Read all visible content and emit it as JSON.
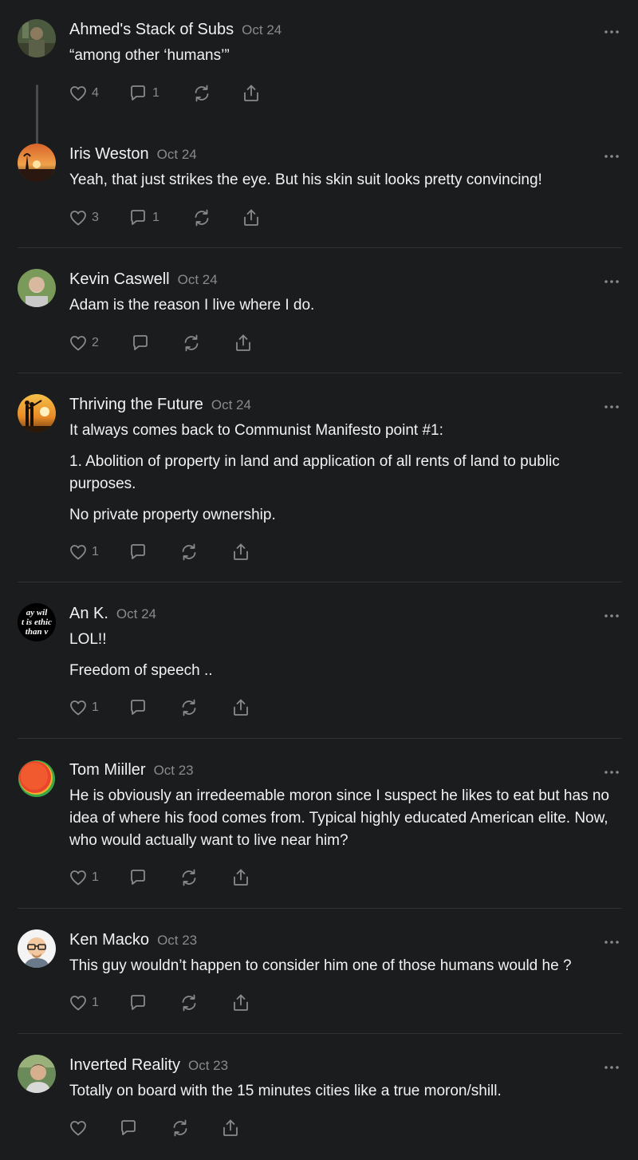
{
  "comments": [
    {
      "author": "Ahmed's Stack of Subs",
      "date": "Oct 24",
      "paragraphs": [
        "“among other ‘humans’”"
      ],
      "likes": "4",
      "replies": "1"
    },
    {
      "author": "Iris Weston",
      "date": "Oct 24",
      "paragraphs": [
        "Yeah, that just strikes the eye. But his skin suit looks pretty convincing!"
      ],
      "likes": "3",
      "replies": "1"
    },
    {
      "author": "Kevin Caswell",
      "date": "Oct 24",
      "paragraphs": [
        "Adam is the reason I live where I do."
      ],
      "likes": "2",
      "replies": ""
    },
    {
      "author": "Thriving the Future",
      "date": "Oct 24",
      "paragraphs": [
        "It always comes back to Communist Manifesto point #1:",
        "1. Abolition of property in land and application of all rents of land to public purposes.",
        "No private property ownership."
      ],
      "likes": "1",
      "replies": ""
    },
    {
      "author": "An K.",
      "date": "Oct 24",
      "avatar_text": [
        "ay wil",
        "t is ethic",
        "than v"
      ],
      "paragraphs": [
        "LOL!!",
        "Freedom of speech .."
      ],
      "likes": "1",
      "replies": ""
    },
    {
      "author": "Tom Miiller",
      "date": "Oct 23",
      "paragraphs": [
        "He is obviously an irredeemable moron since I suspect he likes to eat but has no idea of where his food comes from. Typical highly educated American elite. Now, who would actually want to live near him?"
      ],
      "likes": "1",
      "replies": ""
    },
    {
      "author": "Ken Macko",
      "date": "Oct 23",
      "paragraphs": [
        "This guy wouldn’t happen to consider him one of those humans would he ?"
      ],
      "likes": "1",
      "replies": ""
    },
    {
      "author": "Inverted Reality",
      "date": "Oct 23",
      "paragraphs": [
        "Totally on board with the 15 minutes cities like a true moron/shill."
      ],
      "likes": "",
      "replies": ""
    }
  ],
  "icons": {
    "like": "heart-icon",
    "reply": "speech-bubble-icon",
    "restack": "restack-icon",
    "share": "share-icon",
    "more": "more-dots-icon"
  },
  "colors": {
    "background": "#1b1c1e",
    "text": "#f2f2f2",
    "muted": "#8a8a8e",
    "divider": "#2f3033"
  }
}
